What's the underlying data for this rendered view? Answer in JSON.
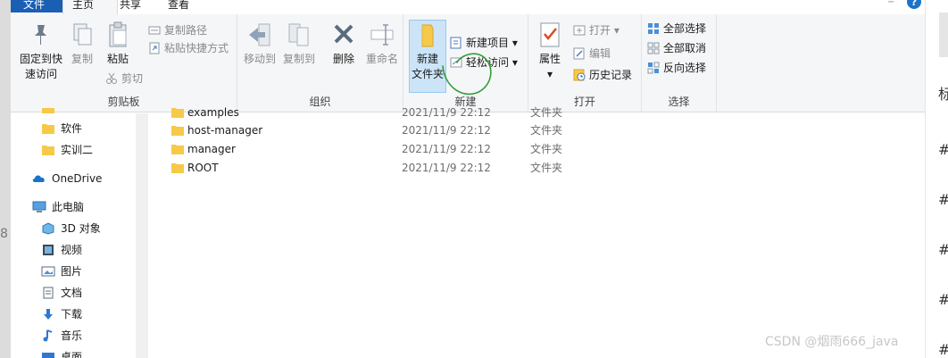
{
  "tabs": {
    "file": "文件",
    "home": "主页",
    "share": "共享",
    "view": "查看"
  },
  "ribbon": {
    "clipboard": {
      "label": "剪贴板",
      "pin_line1": "固定到快",
      "pin_line2": "速访问",
      "copy": "复制",
      "paste": "粘贴",
      "copy_path": "复制路径",
      "paste_shortcut": "粘贴快捷方式",
      "cut": "剪切"
    },
    "organize": {
      "label": "组织",
      "move_to": "移动到",
      "copy_to": "复制到",
      "delete": "删除",
      "rename": "重命名"
    },
    "new": {
      "label": "新建",
      "new_folder_line1": "新建",
      "new_folder_line2": "文件夹",
      "new_item": "新建项目",
      "easy_access": "轻松访问"
    },
    "open": {
      "label": "打开",
      "properties": "属性",
      "open": "打开",
      "edit": "编辑",
      "history": "历史记录"
    },
    "select": {
      "label": "选择",
      "select_all": "全部选择",
      "select_none": "全部取消",
      "invert": "反向选择"
    }
  },
  "nav": {
    "items": [
      {
        "label": "软件",
        "icon": "folder-icon"
      },
      {
        "label": "实训二",
        "icon": "folder-icon"
      },
      {
        "label": "OneDrive",
        "icon": "cloud-icon"
      },
      {
        "label": "此电脑",
        "icon": "computer-icon"
      },
      {
        "label": "3D 对象",
        "icon": "3d-objects-icon"
      },
      {
        "label": "视频",
        "icon": "video-icon"
      },
      {
        "label": "图片",
        "icon": "pictures-icon"
      },
      {
        "label": "文档",
        "icon": "documents-icon"
      },
      {
        "label": "下载",
        "icon": "download-icon"
      },
      {
        "label": "音乐",
        "icon": "music-icon"
      },
      {
        "label": "桌面",
        "icon": "desktop-icon"
      }
    ]
  },
  "files": [
    {
      "name": "examples",
      "date": "2021/11/9 22:12",
      "type": "文件夹"
    },
    {
      "name": "host-manager",
      "date": "2021/11/9 22:12",
      "type": "文件夹"
    },
    {
      "name": "manager",
      "date": "2021/11/9 22:12",
      "type": "文件夹"
    },
    {
      "name": "ROOT",
      "date": "2021/11/9 22:12",
      "type": "文件夹"
    }
  ],
  "watermark": "CSDN @烟雨666_java",
  "background": {
    "left_glyph": "8",
    "right_top": "标",
    "right_hash": "#"
  },
  "colors": {
    "accent": "#1a5fb4",
    "folder": "#f7c948",
    "highlight": "#cce4f7",
    "annotation": "#2e9e3a"
  }
}
